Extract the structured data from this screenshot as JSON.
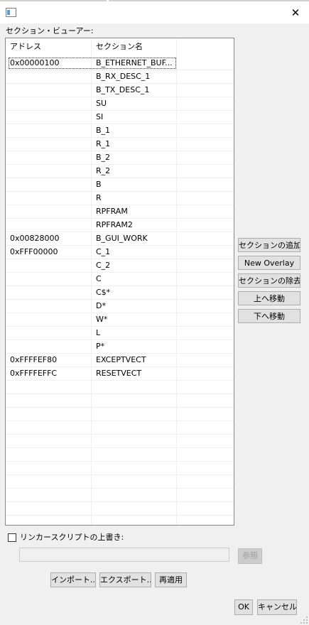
{
  "window": {
    "close_glyph": "✕"
  },
  "section_viewer": {
    "label": "セクション・ビューアー:"
  },
  "table": {
    "headers": [
      "アドレス",
      "セクション名"
    ],
    "rows": [
      {
        "address": "0x00000100",
        "name": "B_ETHERNET_BUF..."
      },
      {
        "address": "",
        "name": "B_RX_DESC_1"
      },
      {
        "address": "",
        "name": "B_TX_DESC_1"
      },
      {
        "address": "",
        "name": "SU"
      },
      {
        "address": "",
        "name": "SI"
      },
      {
        "address": "",
        "name": "B_1"
      },
      {
        "address": "",
        "name": "R_1"
      },
      {
        "address": "",
        "name": "B_2"
      },
      {
        "address": "",
        "name": "R_2"
      },
      {
        "address": "",
        "name": "B"
      },
      {
        "address": "",
        "name": "R"
      },
      {
        "address": "",
        "name": "RPFRAM"
      },
      {
        "address": "",
        "name": "RPFRAM2"
      },
      {
        "address": "0x00828000",
        "name": "B_GUI_WORK"
      },
      {
        "address": "0xFFF00000",
        "name": "C_1"
      },
      {
        "address": "",
        "name": "C_2"
      },
      {
        "address": "",
        "name": "C"
      },
      {
        "address": "",
        "name": "C$*"
      },
      {
        "address": "",
        "name": "D*"
      },
      {
        "address": "",
        "name": "W*"
      },
      {
        "address": "",
        "name": "L"
      },
      {
        "address": "",
        "name": "P*"
      },
      {
        "address": "0xFFFFEF80",
        "name": "EXCEPTVECT"
      },
      {
        "address": "0xFFFFEFFC",
        "name": "RESETVECT"
      }
    ],
    "empty_rows": 10
  },
  "side_buttons": {
    "add_section": "セクションの追加",
    "new_overlay": "New Overlay",
    "remove_section": "セクションの除去",
    "move_up": "上へ移動",
    "move_down": "下へ移動"
  },
  "linker_script": {
    "override_label": "リンカースクリプトの上書き:",
    "checked": false,
    "path_value": "",
    "browse_label": "参照"
  },
  "bottom_buttons": {
    "import": "インポート...",
    "export": "エクスポート...",
    "reapply": "再適用"
  },
  "dialog_buttons": {
    "ok": "OK",
    "cancel": "キャンセル"
  },
  "icons": {
    "app": "window-icon",
    "close": "close-icon",
    "resize": "resize-grip-icon"
  }
}
